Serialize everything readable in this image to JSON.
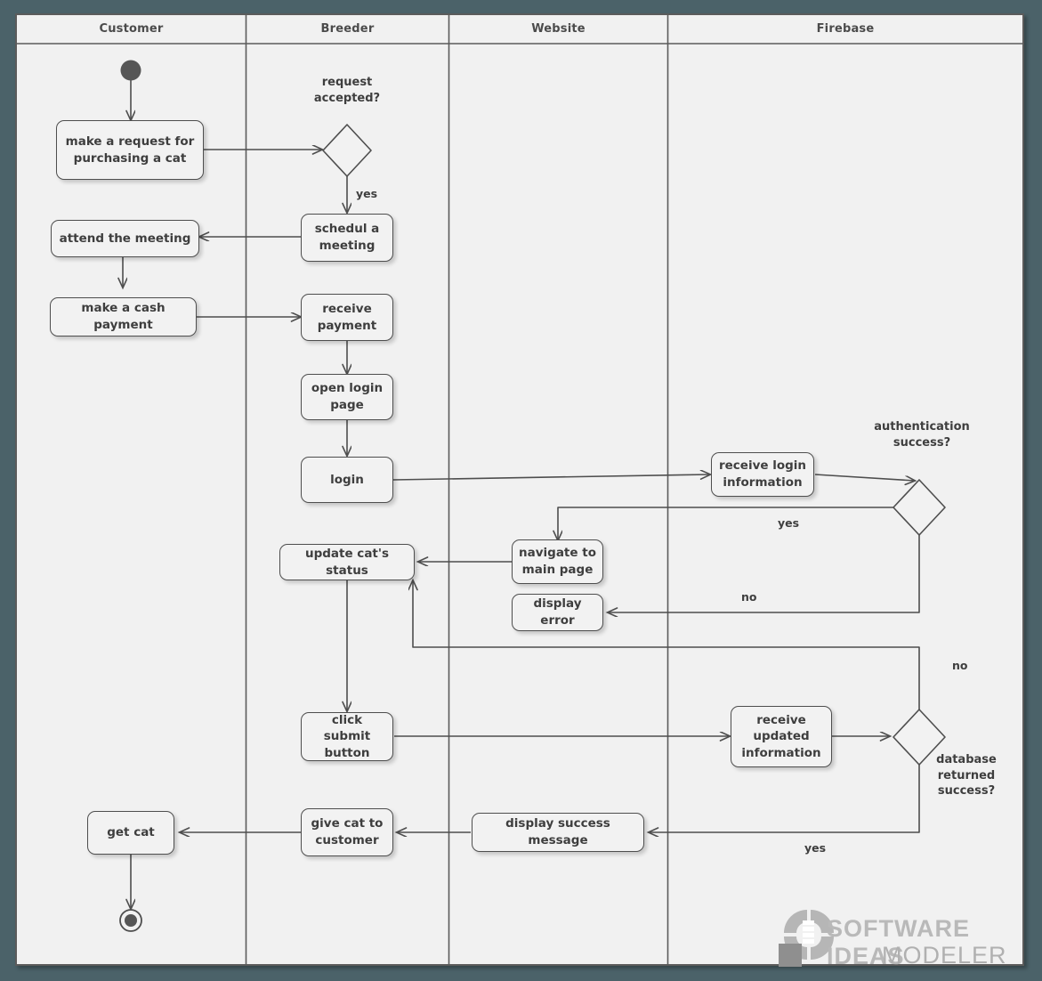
{
  "diagram": {
    "type": "uml-activity-diagram-with-swimlanes",
    "background_color": "#4b6269",
    "canvas_color": "#f1f1f1",
    "border_color": "#5b5b5b"
  },
  "lanes": [
    {
      "title": "Customer"
    },
    {
      "title": "Breeder"
    },
    {
      "title": "Website"
    },
    {
      "title": "Firebase"
    }
  ],
  "nodes": {
    "initial": "initial-node",
    "final": "final-node",
    "make_request": "make a request for\npurchasing a cat",
    "attend_meeting": "attend the meeting",
    "cash_payment": "make a cash payment",
    "get_cat": "get cat",
    "schedule_meeting": "schedul a\nmeeting",
    "receive_payment": "receive\npayment",
    "open_login_page": "open login\npage",
    "login": "login",
    "update_status": "update cat's status",
    "click_submit": "click submit\nbutton",
    "give_cat": "give cat to\ncustomer",
    "navigate_main": "navigate to\nmain page",
    "display_error": "display error",
    "display_success": "display success message",
    "receive_login_info": "receive login\ninformation",
    "receive_updated_info": "receive\nupdated\ninformation"
  },
  "decisions": {
    "request_accepted": "request\naccepted?",
    "authentication_success": "authentication\nsuccess?",
    "database_returned_success": "database\nreturned\nsuccess?"
  },
  "edge_labels": {
    "request_yes": "yes",
    "auth_yes": "yes",
    "auth_no": "no",
    "db_no": "no",
    "db_yes": "yes"
  },
  "watermark": {
    "line1": "SOFTWARE IDEAS",
    "line2": "MODELER"
  }
}
